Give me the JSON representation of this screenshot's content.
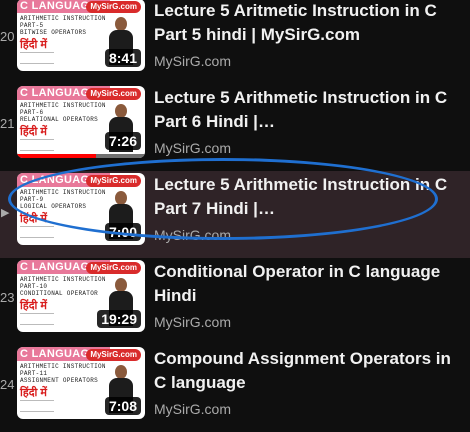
{
  "playlist": [
    {
      "index": "20",
      "title": "Lecture 5 Aritmetic Instruction in C Part 5 hindi | MySirG.com",
      "channel": "MySirG.com",
      "duration": "8:41",
      "watched_fraction": 0,
      "thumb": {
        "band": "C LANGUAGE",
        "line1": "ARITHMETIC INSTRUCTION",
        "line2": "PART-5",
        "line3": "BITWISE OPERATORS",
        "hindi": "हिंदी में",
        "logo": "MySirG.com"
      }
    },
    {
      "index": "21",
      "title": "Lecture 5 Arithmetic Instruction in C Part 6 Hindi |…",
      "channel": "MySirG.com",
      "duration": "7:26",
      "watched_fraction": 0.62,
      "thumb": {
        "band": "C LANGUAGE",
        "line1": "ARITHMETIC INSTRUCTION",
        "line2": "PART-6",
        "line3": "RELATIONAL OPERATORS",
        "hindi": "हिंदी में",
        "logo": "MySirG.com"
      }
    },
    {
      "index": "",
      "title": "Lecture 5 Arithmetic Instruction in C Part 7 Hindi |…",
      "channel": "MySirG.com",
      "duration": "7:00",
      "watched_fraction": 0,
      "active": true,
      "thumb": {
        "band": "C LANGUAGE",
        "line1": "ARITHMETIC INSTRUCTION",
        "line2": "PART-9",
        "line3": "LOGICAL OPERATORS",
        "hindi": "हिंदी में",
        "logo": "MySirG.com"
      }
    },
    {
      "index": "23",
      "title": "Conditional Operator in C language Hindi",
      "channel": "MySirG.com",
      "duration": "19:29",
      "watched_fraction": 0,
      "thumb": {
        "band": "C LANGUAGE",
        "line1": "ARITHMETIC INSTRUCTION",
        "line2": "PART-10",
        "line3": "CONDITIONAL OPERATOR",
        "hindi": "हिंदी में",
        "logo": "MySirG.com"
      }
    },
    {
      "index": "24",
      "title": "Compound Assignment Operators in C language",
      "channel": "MySirG.com",
      "duration": "7:08",
      "watched_fraction": 0,
      "thumb": {
        "band": "C LANGUAGE",
        "line1": "ARITHMETIC INSTRUCTION",
        "line2": "PART-11",
        "line3": "ASSIGNMENT OPERATORS",
        "hindi": "हिंदी में",
        "logo": "MySirG.com"
      }
    }
  ],
  "colors": {
    "background": "#0f0f0f",
    "active_row": "#2f2327",
    "annotation_circle": "#1f6fd0",
    "progress": "#ff0000"
  },
  "icons": {
    "now_playing": "play-arrow-icon"
  }
}
